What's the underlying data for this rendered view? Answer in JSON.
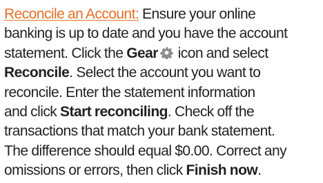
{
  "tip": {
    "heading_link": "Reconcile an Account:",
    "line1_text": " Ensure your online",
    "line2_text": "banking is up to date and you have the account",
    "line3_pre": "statement. Click the ",
    "gear_bold": "Gear",
    "gear_icon": "gear-icon",
    "line3_post": " icon and select",
    "reconcile_bold": "Reconcile",
    "line4_text": ". Select the account you want to",
    "line5_text": "reconcile. Enter the statement information",
    "line6_pre": "and click ",
    "start_reconciling_bold": "Start reconciling",
    "line6_post": ". Check off the",
    "line7_text": "transactions that match your bank statement.",
    "line8_text": "The difference should equal $0.00. Correct any",
    "line9_pre": "omissions or errors, then click ",
    "finish_now_bold": "Finish now",
    "line9_post": ".",
    "link_color": "#e56f27",
    "text_color": "#231f20",
    "icon_color": "#8a8c8e"
  }
}
